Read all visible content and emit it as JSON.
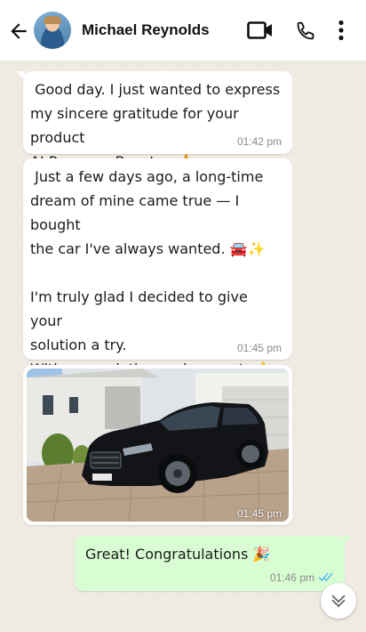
{
  "header": {
    "contact_name": "Michael Reynolds",
    "icons": [
      "back-arrow-icon",
      "video-call-icon",
      "phone-call-icon",
      "more-options-icon"
    ]
  },
  "messages": [
    {
      "direction": "incoming",
      "text": " Good day. I just wanted to express\nmy sincere gratitude for your product\nAI Revenue Booster. 🙏",
      "time": "01:42 pm"
    },
    {
      "direction": "incoming",
      "text": " Just a few days ago, a long-time\ndream of mine came true — I bought\nthe car I've always wanted. 🚘✨\n\nI'm truly glad I decided to give your\nsolution a try.\nWith appreciation and respect. 👍🙂",
      "time": "01:45 pm"
    },
    {
      "direction": "incoming",
      "type": "image",
      "time": "01:45 pm"
    },
    {
      "direction": "outgoing",
      "text": "Great! Congratulations 🎉",
      "time": "01:46 pm",
      "status": "read"
    }
  ],
  "colors": {
    "chat_background": "#efeae2",
    "incoming_bubble": "#ffffff",
    "outgoing_bubble": "#d9fdd3",
    "read_ticks": "#53bdeb"
  }
}
